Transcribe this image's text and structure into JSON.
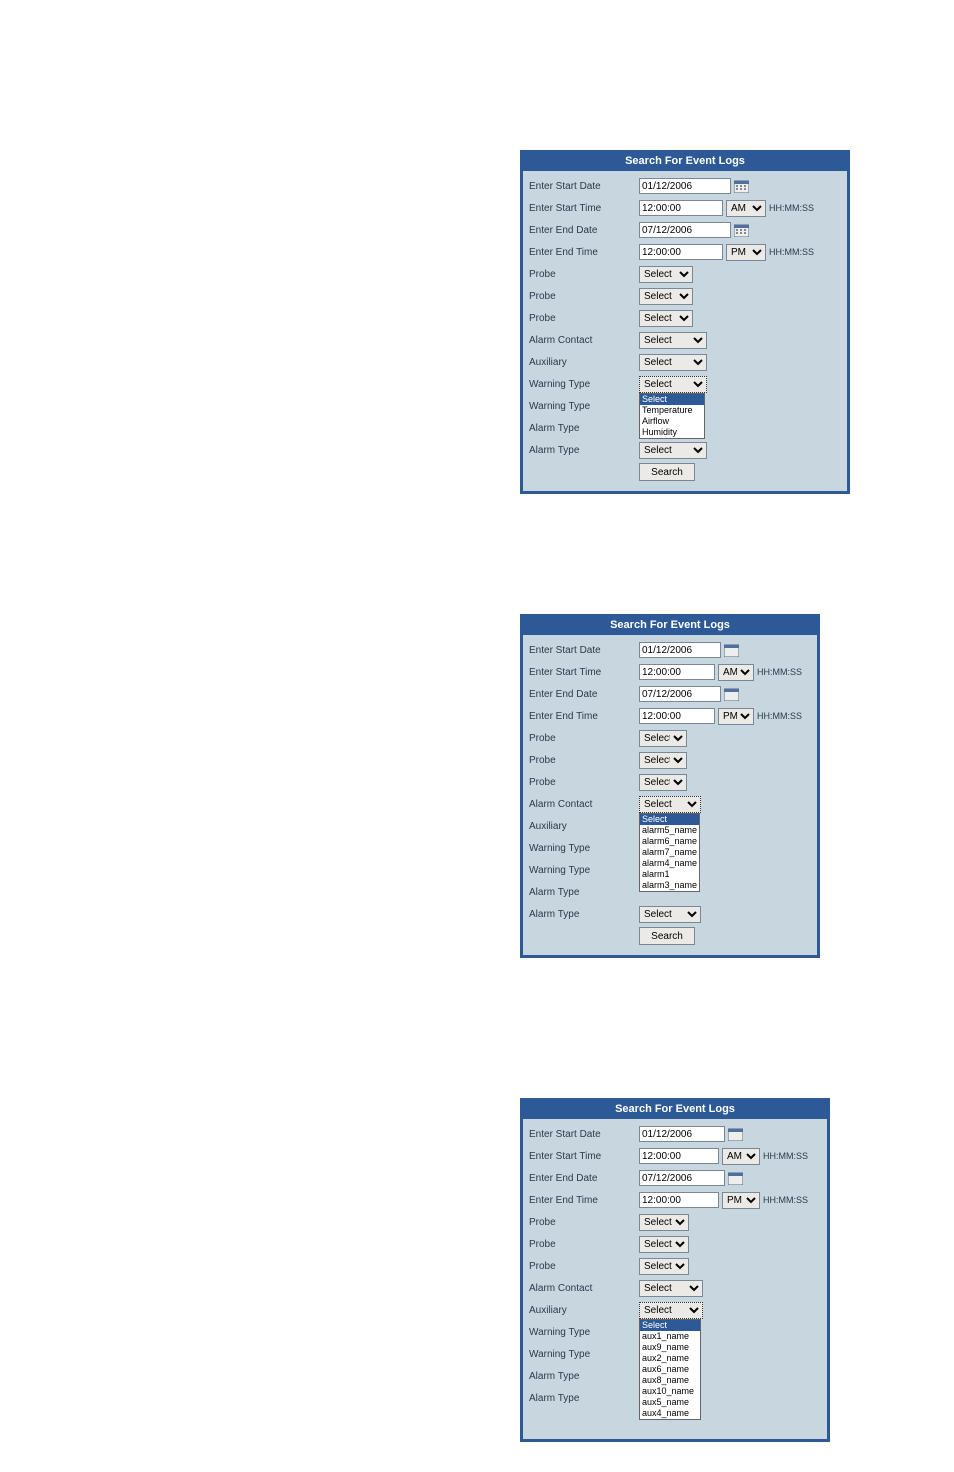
{
  "header_title": "Search For Event Logs",
  "labels": {
    "start_date": "Enter Start Date",
    "start_time": "Enter Start Time",
    "end_date": "Enter End Date",
    "end_time": "Enter End Time",
    "probe": "Probe",
    "alarm_contact": "Alarm Contact",
    "auxiliary": "Auxiliary",
    "warning_type": "Warning Type",
    "alarm_type": "Alarm Type"
  },
  "values": {
    "start_date": "01/12/2006",
    "start_time": "12:00:00",
    "end_date": "07/12/2006",
    "end_time": "12:00:00",
    "select": "Select",
    "ampm_am": "AM",
    "ampm_pm": "PM",
    "time_hint": "HH:MM:SS",
    "search_btn": "Search"
  },
  "panel1_dd": {
    "options": [
      "Select",
      "Temperature",
      "Airflow",
      "Humidity"
    ]
  },
  "panel2_dd": {
    "options": [
      "Select",
      "alarm5_name",
      "alarm6_name",
      "alarm7_name",
      "alarm4_name",
      "alarm1",
      "alarm3_name"
    ]
  },
  "panel3_dd": {
    "options": [
      "Select",
      "aux1_name",
      "aux9_name",
      "aux2_name",
      "aux6_name",
      "aux8_name",
      "aux10_name",
      "aux5_name",
      "aux4_name"
    ]
  }
}
